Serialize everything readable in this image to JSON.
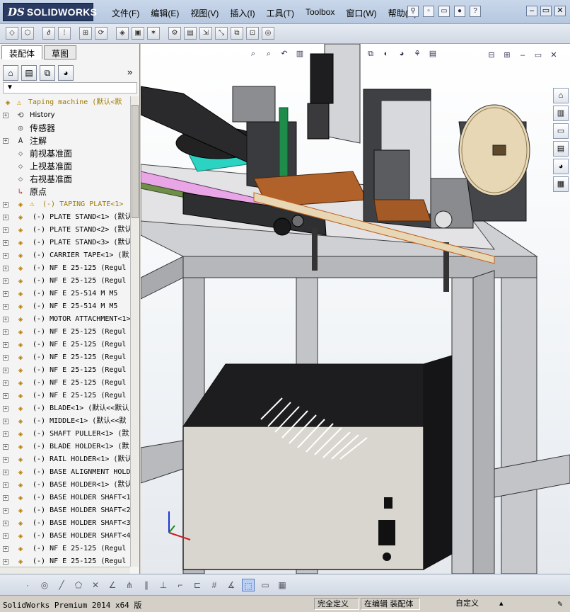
{
  "app": {
    "logo_ds": "DS",
    "logo_name": "SOLIDWORKS"
  },
  "menu": [
    "文件(F)",
    "编辑(E)",
    "视图(V)",
    "插入(I)",
    "工具(T)",
    "Toolbox",
    "窗口(W)",
    "帮助(H)"
  ],
  "panel_tabs": [
    "装配体",
    "草图"
  ],
  "tree": {
    "root": "Taping machine  (默认<默",
    "history": "History",
    "sensors": "传感器",
    "annotations": "注解",
    "front_plane": "前视基准面",
    "top_plane": "上视基准面",
    "right_plane": "右视基准面",
    "origin": "原点",
    "components": [
      "(-) TAPING PLATE<1>",
      "(-) PLATE STAND<1>  (默认",
      "(-) PLATE STAND<2>  (默认",
      "(-) PLATE STAND<3>  (默认",
      "(-) CARRIER TAPE<1>  (默",
      "(-) NF E 25-125   (Regul",
      "(-) NF E 25-125   (Regul",
      "(-) NF E 25-514  M M5",
      "(-) NF E 25-514  M M5",
      "(-) MOTOR ATTACHMENT<1>",
      "(-) NF E 25-125   (Regul",
      "(-) NF E 25-125   (Regul",
      "(-) NF E 25-125   (Regul",
      "(-) NF E 25-125   (Regul",
      "(-) NF E 25-125   (Regul",
      "(-) NF E 25-125   (Regul",
      "(-) BLADE<1>  (默认<<默认",
      "(-) MIDDLE<1>  (默认<<默",
      "(-) SHAFT PULLER<1>  (默",
      "(-) BLADE HOLDER<1>  (默",
      "(-) RAIL HOLDER<1>  (默认",
      "(-) BASE ALIGNMENT HOLD",
      "(-) BASE HOLDER<1>  (默认",
      "(-) BASE HOLDER SHAFT<1",
      "(-) BASE HOLDER SHAFT<2",
      "(-) BASE HOLDER SHAFT<3",
      "(-) BASE HOLDER SHAFT<4",
      "(-) NF E 25-125   (Regul",
      "(-) NF E 25-125   (Regul"
    ]
  },
  "status": {
    "app": "SolidWorks Premium 2014 x64 版",
    "definition": "完全定义",
    "mode": "在编辑 装配体",
    "units": "自定义"
  },
  "colors": {
    "title_bar": "#b5c7df",
    "logo_bg": "#2a3b63",
    "frame_gray": "#c8c9cd",
    "plate_pink": "#e9a6e6",
    "teal_panel": "#2ad3c2",
    "tape_beige": "#e8d7b5",
    "copper": "#b0622a"
  },
  "icons": {
    "filter": "funnel-icon",
    "warning": "warning-icon"
  }
}
